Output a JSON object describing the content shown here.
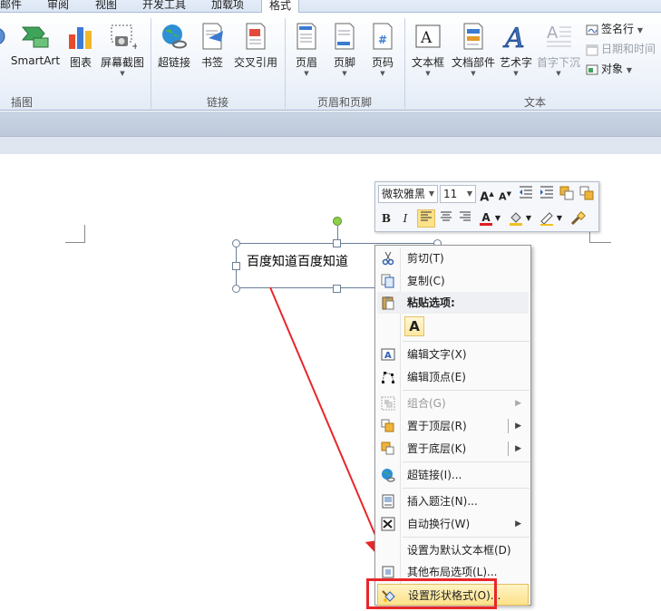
{
  "ribbon": {
    "tabs": [
      "邮件",
      "审阅",
      "视图",
      "开发工具",
      "加载项",
      "格式"
    ],
    "active_tab": "格式",
    "illustrations": {
      "smartart": "SmartArt",
      "chart": "图表",
      "screenshot": "屏幕截图",
      "group_label": "插图"
    },
    "links": {
      "hyperlink": "超链接",
      "bookmark": "书签",
      "crossref": "交叉引用",
      "group_label": "链接"
    },
    "header_footer": {
      "header": "页眉",
      "footer": "页脚",
      "page_number": "页码",
      "group_label": "页眉和页脚"
    },
    "text": {
      "textbox": "文本框",
      "quickparts": "文档部件",
      "wordart": "艺术字",
      "dropcap": "首字下沉",
      "signature": "签名行",
      "datetime": "日期和时间",
      "object": "对象",
      "group_label": "文本"
    }
  },
  "document": {
    "textbox_text": "百度知道百度知道"
  },
  "mini_toolbar": {
    "font_name": "微软雅黑",
    "font_size": "11"
  },
  "context_menu": {
    "items": [
      {
        "label": "剪切(T)"
      },
      {
        "label": "复制(C)"
      },
      {
        "label": "粘贴选项:"
      },
      {
        "label": "编辑文字(X)"
      },
      {
        "label": "编辑顶点(E)"
      },
      {
        "label": "组合(G)"
      },
      {
        "label": "置于顶层(R)"
      },
      {
        "label": "置于底层(K)"
      },
      {
        "label": "超链接(I)..."
      },
      {
        "label": "插入题注(N)..."
      },
      {
        "label": "自动换行(W)"
      },
      {
        "label": "设置为默认文本框(D)"
      },
      {
        "label": "其他布局选项(L)..."
      },
      {
        "label": "设置形状格式(O)..."
      }
    ],
    "paste_option": "A"
  },
  "colors": {
    "highlight_frame": "#e8262a",
    "menu_highlight": "#fde28a",
    "rotate_handle": "#8ed04a"
  }
}
